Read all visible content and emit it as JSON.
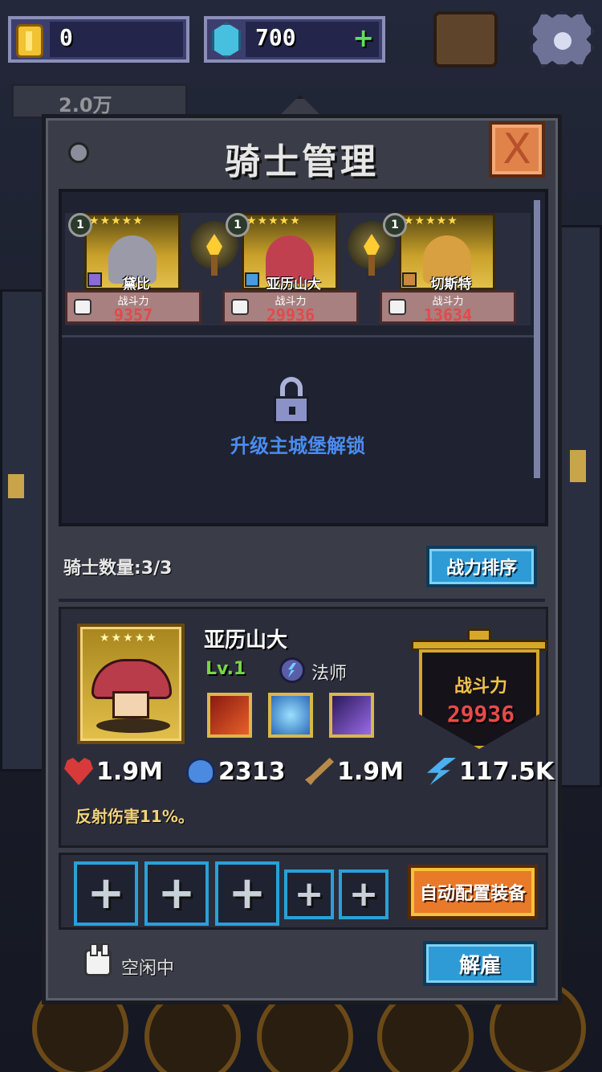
{
  "topbar": {
    "coins": "0",
    "gems": "700",
    "gems_add": "+",
    "ticker": "2.0万"
  },
  "panel": {
    "title": "骑士管理",
    "close_label": "X",
    "knights": [
      {
        "level": "1",
        "stars": "★★★★★",
        "name": "黛比",
        "power_label": "战斗力",
        "power": "9357",
        "color": "#9a9aa8"
      },
      {
        "level": "1",
        "stars": "★★★★★",
        "name": "亚历山大",
        "power_label": "战斗力",
        "power": "29936",
        "color": "#c04050"
      },
      {
        "level": "1",
        "stars": "★★★★★",
        "name": "切斯特",
        "power_label": "战斗力",
        "power": "13634",
        "color": "#d8a040"
      }
    ],
    "unlock_text": "升级主城堡解锁",
    "knight_count": "骑士数量:3/3",
    "rank_button": "战力排序"
  },
  "detail": {
    "stars": "★★★★★",
    "name": "亚历山大",
    "level": "Lv.1",
    "class": "法师",
    "power_label": "战斗力",
    "power": "29936",
    "stats": {
      "hp": "1.9M",
      "mana": "2313",
      "attack": "1.9M",
      "speed": "117.5K"
    },
    "passive": "反射伤害11%。"
  },
  "equip": {
    "slot_symbol": "+",
    "auto_button": "自动配置装备"
  },
  "footer": {
    "status": "空闲中",
    "dismiss_button": "解雇"
  },
  "colors": {
    "accent_blue": "#2f9bd6",
    "gold": "#d8a62a",
    "power_red": "#e84a4a"
  }
}
